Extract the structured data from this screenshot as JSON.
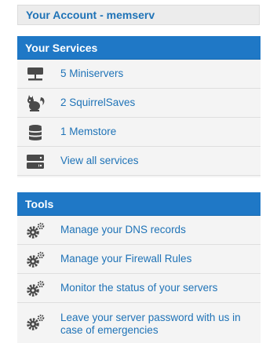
{
  "account": {
    "title": "Your Account - memserv"
  },
  "services": {
    "header": "Your Services",
    "items": [
      {
        "label": "5 Miniservers",
        "icon": "server-icon"
      },
      {
        "label": "2 SquirrelSaves",
        "icon": "squirrel-icon"
      },
      {
        "label": "1 Memstore",
        "icon": "database-icon"
      },
      {
        "label": "View all services",
        "icon": "server-stack-icon"
      }
    ]
  },
  "tools": {
    "header": "Tools",
    "items": [
      {
        "label": "Manage your DNS records",
        "icon": "gears-icon"
      },
      {
        "label": "Manage your Firewall Rules",
        "icon": "gears-icon"
      },
      {
        "label": "Monitor the status of your servers",
        "icon": "gears-icon"
      },
      {
        "label": "Leave your server password with us in case of emergencies",
        "icon": "gears-icon"
      }
    ]
  },
  "colors": {
    "accent": "#1f78c6",
    "link": "#1f73b7",
    "panel_bg": "#f4f4f4",
    "icon": "#4a4a4a"
  }
}
